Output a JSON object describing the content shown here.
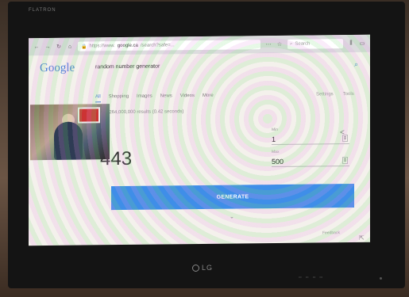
{
  "monitor": {
    "top_brand": "FLATRON",
    "bottom_brand": "LG"
  },
  "browser": {
    "url_prefix": "https://www.",
    "url_domain": "google.ca",
    "url_rest": "/search?safe=...",
    "search_placeholder": "Search"
  },
  "google": {
    "logo": "Google",
    "query": "random number generator",
    "tabs": [
      "All",
      "Shopping",
      "Images",
      "News",
      "Videos",
      "More"
    ],
    "tabs_right": [
      "Settings",
      "Tools"
    ],
    "result_stats": "About 264,000,000 results (0.42 seconds)"
  },
  "rng": {
    "number": "443",
    "min_label": "Min",
    "min_value": "1",
    "max_label": "Max",
    "max_value": "500",
    "button_label": "GENERATE",
    "feedback": "Feedback"
  },
  "icons": [
    "back-icon",
    "forward-icon",
    "reload-icon",
    "home-icon",
    "lock-icon",
    "search-icon",
    "share-icon",
    "chevron-down-icon"
  ]
}
